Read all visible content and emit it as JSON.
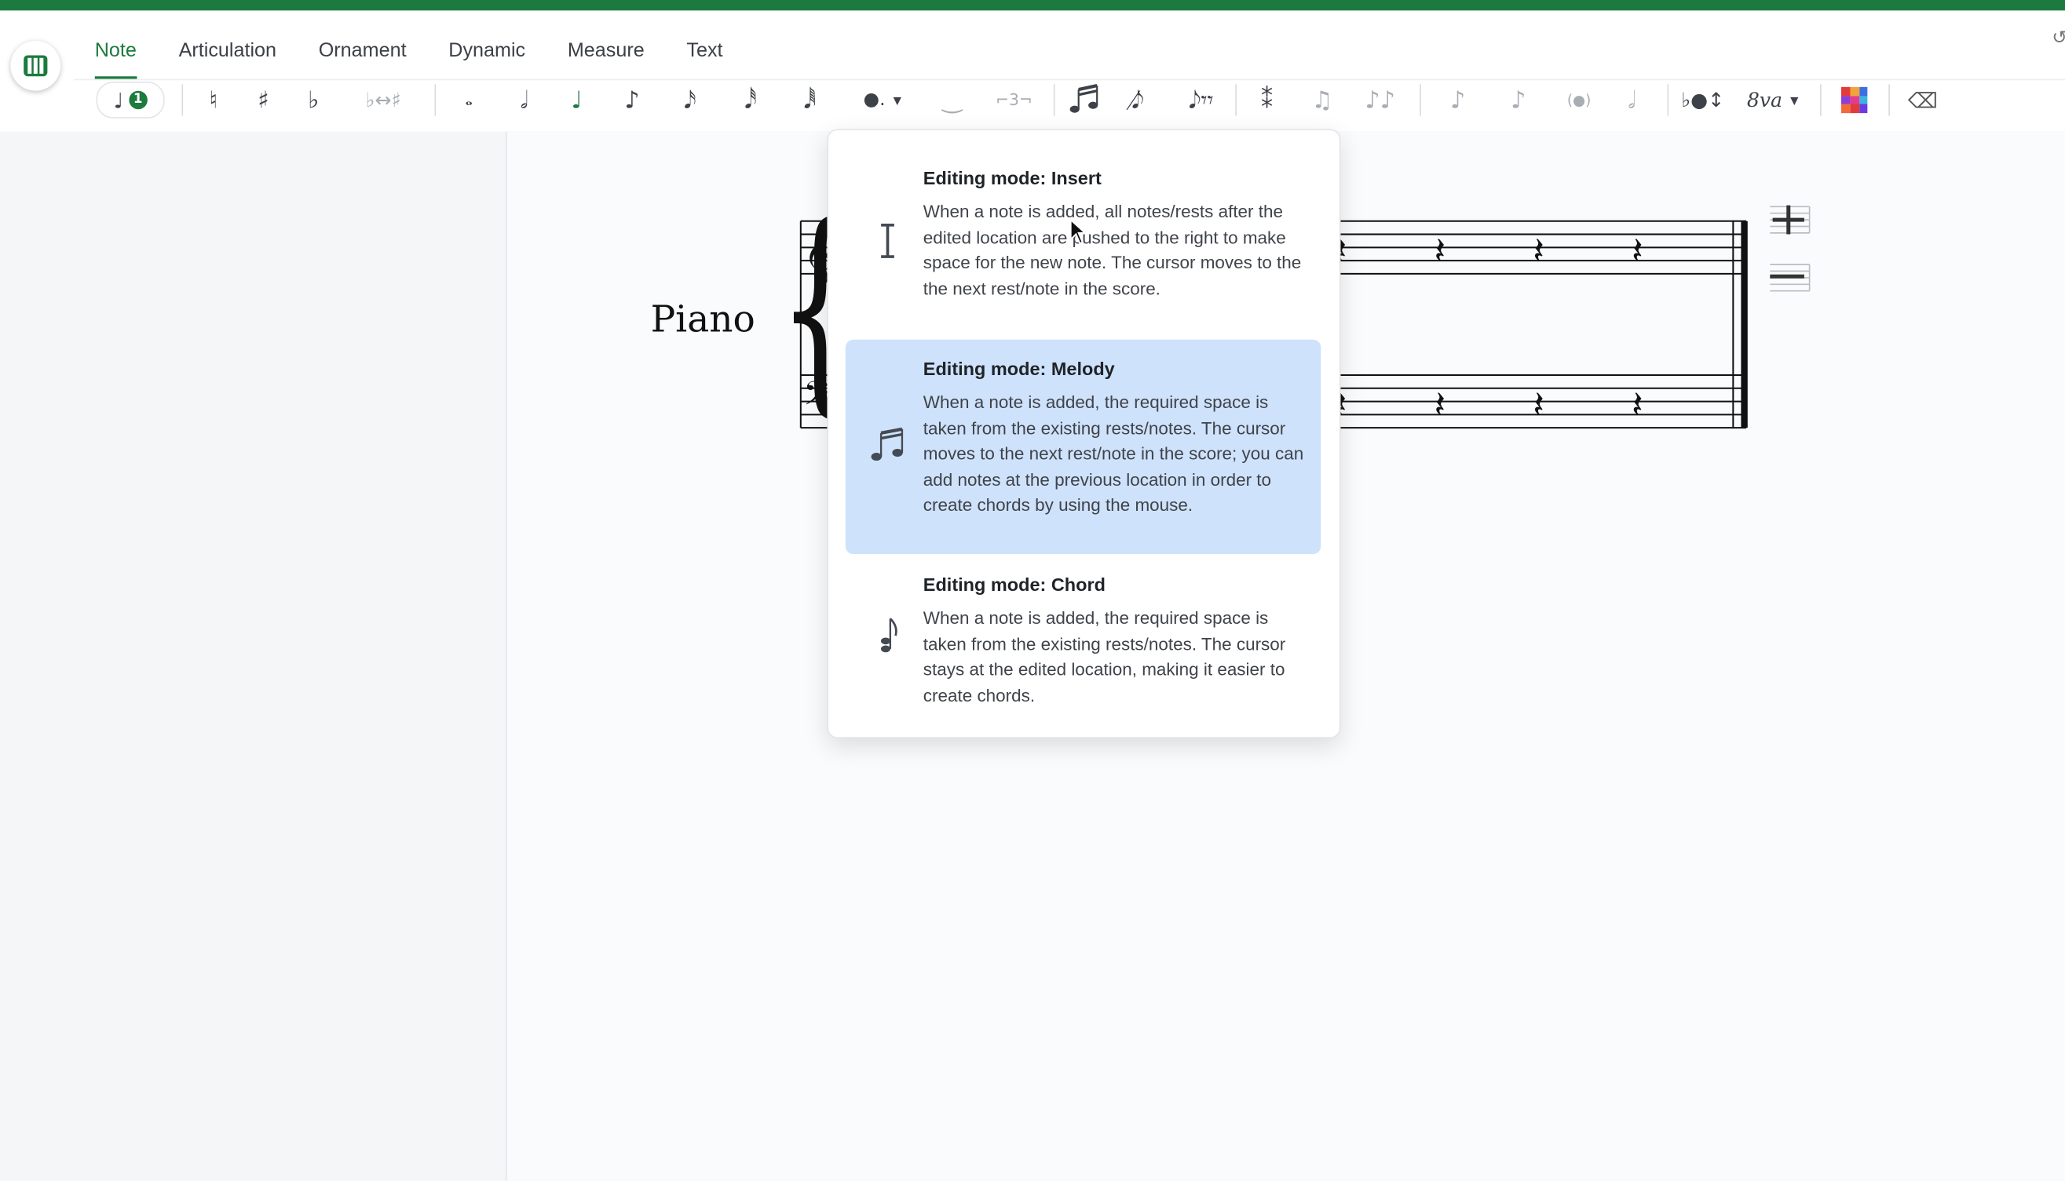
{
  "tabs": [
    {
      "label": "Note",
      "active": true
    },
    {
      "label": "Articulation"
    },
    {
      "label": "Ornament"
    },
    {
      "label": "Dynamic"
    },
    {
      "label": "Measure"
    },
    {
      "label": "Text"
    }
  ],
  "toolbar": {
    "voice_badge": "1",
    "tuplet_label": "⌐3¬",
    "ottava_label": "8va"
  },
  "score": {
    "instrument": "Piano"
  },
  "editing_modes": [
    {
      "title": "Editing mode: Insert",
      "description": "When a note is added, all notes/rests after the edited location are pushed to the right to make space for the new note. The cursor moves to the the next rest/note in the score.",
      "icon": "insert-cursor-icon"
    },
    {
      "title": "Editing mode: Melody",
      "description": "When a note is added, the required space is taken from the existing rests/notes. The cursor moves to the next rest/note in the score; you can add notes at the previous location in order to create chords by using the mouse.",
      "icon": "beamed-notes-icon",
      "selected": true
    },
    {
      "title": "Editing mode: Chord",
      "description": "When a note is added, the required space is taken from the existing rests/notes. The cursor stays at the edited location, making it easier to create chords.",
      "icon": "chord-icon"
    }
  ],
  "colors": {
    "accent": "#1c7a3e",
    "selected_option": "#cfe2fb"
  }
}
